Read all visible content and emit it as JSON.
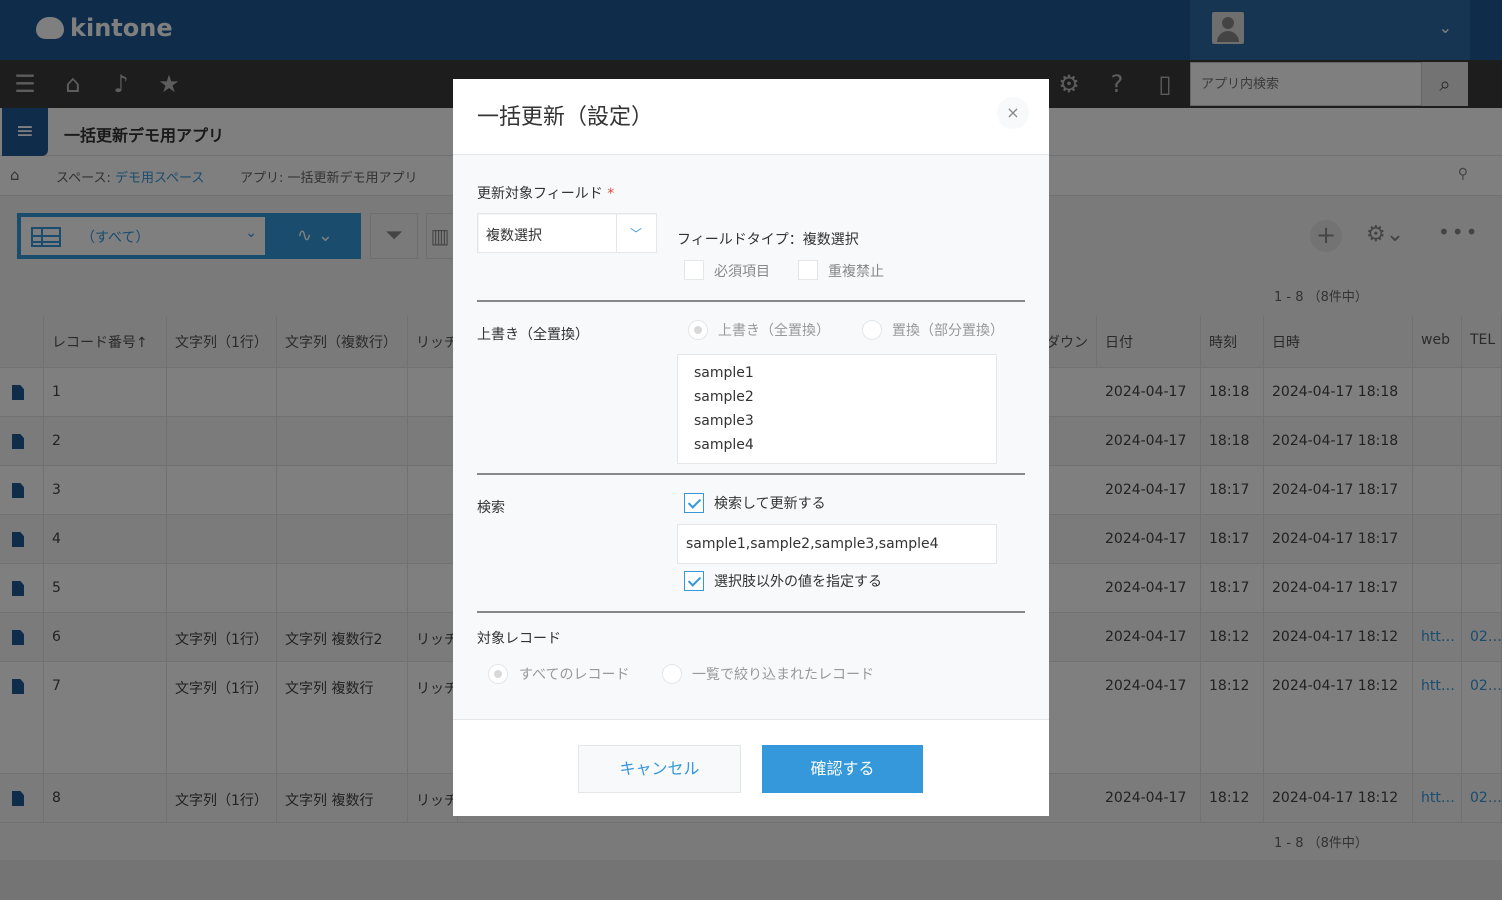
{
  "brand": {
    "name": "kintone"
  },
  "header": {
    "user_chevron": "⌄"
  },
  "nav": {
    "search_placeholder": "アプリ内検索"
  },
  "app": {
    "title": "一括更新デモ用アプリ"
  },
  "breadcrumb": {
    "space_prefix": "スペース:",
    "space_name": "デモ用スペース",
    "app_label": "アプリ: 一括更新デモ用アプリ"
  },
  "toolbar": {
    "view_label": "（すべて）",
    "count_top": "1 - 8 （8件中）"
  },
  "table": {
    "headers": [
      "レコード番号↑",
      "文字列（1行）",
      "文字列（複数行）",
      "リッチ",
      "ダウン",
      "日付",
      "時刻",
      "日時",
      "web",
      "TEL"
    ],
    "rows": [
      {
        "id": "1",
        "text1": "",
        "textm": "",
        "rich": "",
        "date": "2024-04-17",
        "time": "18:18",
        "datetime": "2024-04-17 18:18",
        "web": "",
        "tel": ""
      },
      {
        "id": "2",
        "text1": "",
        "textm": "",
        "rich": "",
        "date": "2024-04-17",
        "time": "18:18",
        "datetime": "2024-04-17 18:18",
        "web": "",
        "tel": ""
      },
      {
        "id": "3",
        "text1": "",
        "textm": "",
        "rich": "",
        "date": "2024-04-17",
        "time": "18:17",
        "datetime": "2024-04-17 18:17",
        "web": "",
        "tel": ""
      },
      {
        "id": "4",
        "text1": "",
        "textm": "",
        "rich": "",
        "date": "2024-04-17",
        "time": "18:17",
        "datetime": "2024-04-17 18:17",
        "web": "",
        "tel": ""
      },
      {
        "id": "5",
        "text1": "",
        "textm": "",
        "rich": "",
        "date": "2024-04-17",
        "time": "18:17",
        "datetime": "2024-04-17 18:17",
        "web": "",
        "tel": ""
      },
      {
        "id": "6",
        "text1": "文字列（1行）",
        "textm": "文字列 複数行2",
        "rich": "リッチ",
        "date": "2024-04-17",
        "time": "18:12",
        "datetime": "2024-04-17 18:12",
        "web": "htt…",
        "tel": "02…"
      },
      {
        "id": "7",
        "text1": "文字列（1行）",
        "textm": "文字列 複数行",
        "rich": "リッチ",
        "date": "2024-04-17",
        "time": "18:12",
        "datetime": "2024-04-17 18:12",
        "web": "htt…",
        "tel": "02…"
      },
      {
        "id": "8",
        "text1": "文字列（1行）",
        "textm": "文字列 複数行",
        "rich": "リッチ",
        "date": "2024-04-17",
        "time": "18:12",
        "datetime": "2024-04-17 18:12",
        "web": "htt…",
        "tel": "02…"
      }
    ],
    "count_bottom": "1 - 8 （8件中）"
  },
  "dialog": {
    "title": "一括更新（設定）",
    "close": "×",
    "target_field": {
      "label": "更新対象フィールド",
      "required_mark": "*",
      "selected": "複数選択",
      "field_type": "フィールドタイプ：複数選択",
      "required_item": "必須項目",
      "no_duplicate": "重複禁止"
    },
    "overwrite": {
      "label": "上書き（全置換）",
      "option_full": "上書き（全置換）",
      "option_partial": "置換（部分置換）",
      "options": [
        "sample1",
        "sample2",
        "sample3",
        "sample4"
      ]
    },
    "search": {
      "label": "検索",
      "search_update": "検索して更新する",
      "value": "sample1,sample2,sample3,sample4",
      "specify_other": "選択肢以外の値を指定する"
    },
    "target_records": {
      "label": "対象レコード",
      "all": "すべてのレコード",
      "filtered": "一覧で絞り込まれたレコード"
    },
    "cancel": "キャンセル",
    "confirm": "確認する"
  },
  "colors": {
    "header": "#1f5b95",
    "accent": "#3498db",
    "required": "#e74c3c"
  }
}
